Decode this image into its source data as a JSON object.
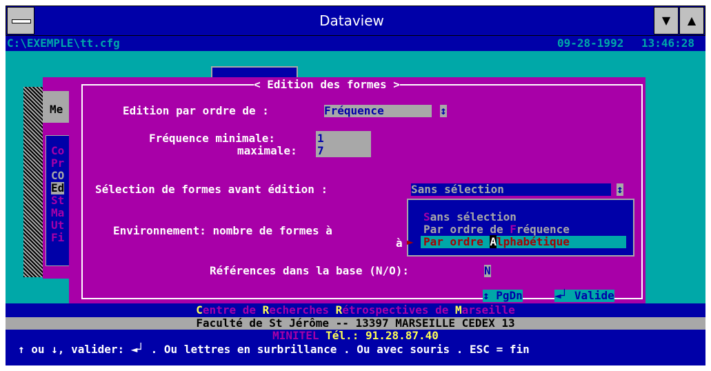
{
  "window": {
    "title": "Dataview",
    "minimize_glyph": "▼",
    "maximize_glyph": "▲"
  },
  "infobar": {
    "path": "C:\\EXEMPLE\\tt.cfg",
    "date": "09-28-1992",
    "time": "13:46:28"
  },
  "bgmenu": {
    "header": "Me",
    "items": [
      "Co",
      "Pr",
      "CO",
      "Ed",
      "St",
      "Ma",
      "Ut",
      "Fi"
    ]
  },
  "dialog": {
    "title": "< Edition des formes >",
    "edition_label": "Edition par ordre de :",
    "edition_value": "Fréquence   ",
    "arrow_glyph": "↕",
    "freq_min_label": "Fréquence minimale:",
    "freq_min_value": "1",
    "freq_max_label": "maximale:",
    "freq_max_value": "7",
    "selection_label": "Sélection de formes avant édition :",
    "selection_value": "Sans sélection",
    "env_label": "Environnement: nombre de formes à",
    "env_label2": "à",
    "refs_label": "Références dans la base (N/O):",
    "refs_value": "N",
    "pgdn_label": "PgDn",
    "valide_label": "Valide",
    "enter_glyph": "◄┘"
  },
  "dropdown": {
    "options": [
      {
        "hot": "S",
        "rest": "ans sélection"
      },
      {
        "pre": "Par ordre de ",
        "hot": "F",
        "rest": "réquence"
      },
      {
        "pre": "Par ordre ",
        "hot": "A",
        "rest": "lphabétique"
      }
    ],
    "selected_index": 2,
    "pointer_glyph": "►"
  },
  "footer": {
    "line1": "Centre de Recherches Rétrospectives de Marseille",
    "line2": "Faculté de St Jérôme -- 13397 MARSEILLE CEDEX 13",
    "minitel": "MINITEL",
    "tel": "Tél.: 91.28.87.40",
    "help": "↑ ou ↓, valider: ◄┘ . Ou lettres en surbrillance . Ou avec souris . ESC = fin"
  },
  "colors": {
    "window_blue": "#0000a8",
    "screen_cyan": "#00a8a8",
    "dialog_magenta": "#a800a8",
    "field_gray": "#a8a8a8",
    "highlight_yellow": "#ffff55",
    "hot_red": "#a80000"
  }
}
